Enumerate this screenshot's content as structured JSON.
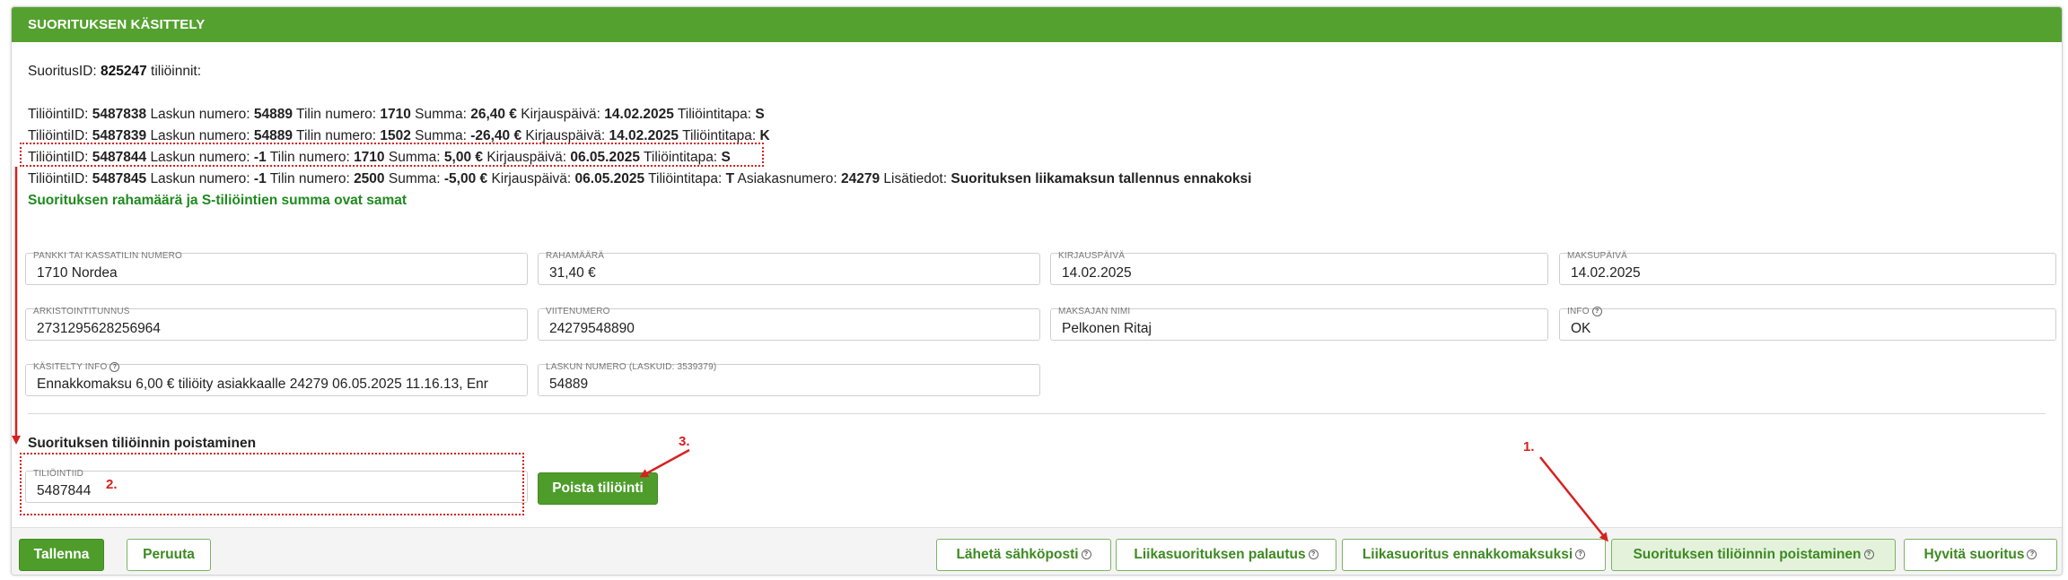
{
  "header": {
    "title": "SUORITUKSEN KÄSITTELY"
  },
  "suoritus": {
    "label": "SuoritusID:",
    "id": "825247",
    "suffix": "tiliöinnit:"
  },
  "entries": [
    {
      "tid_label": "TiliöintiID:",
      "tid": "5487838",
      "laskun_label": "Laskun numero:",
      "laskun": "54889",
      "tilin_label": "Tilin numero:",
      "tilin": "1710",
      "summa_label": "Summa:",
      "summa": "26,40 €",
      "kirj_label": "Kirjauspäivä:",
      "kirj": "14.02.2025",
      "tapa_label": "Tiliöintitapa:",
      "tapa": "S"
    },
    {
      "tid_label": "TiliöintiID:",
      "tid": "5487839",
      "laskun_label": "Laskun numero:",
      "laskun": "54889",
      "tilin_label": "Tilin numero:",
      "tilin": "1502",
      "summa_label": "Summa:",
      "summa": "-26,40 €",
      "kirj_label": "Kirjauspäivä:",
      "kirj": "14.02.2025",
      "tapa_label": "Tiliöintitapa:",
      "tapa": "K"
    },
    {
      "tid_label": "TiliöintiID:",
      "tid": "5487844",
      "laskun_label": "Laskun numero:",
      "laskun": "-1",
      "tilin_label": "Tilin numero:",
      "tilin": "1710",
      "summa_label": "Summa:",
      "summa": "5,00 €",
      "kirj_label": "Kirjauspäivä:",
      "kirj": "06.05.2025",
      "tapa_label": "Tiliöintitapa:",
      "tapa": "S"
    },
    {
      "tid_label": "TiliöintiID:",
      "tid": "5487845",
      "laskun_label": "Laskun numero:",
      "laskun": "-1",
      "tilin_label": "Tilin numero:",
      "tilin": "2500",
      "summa_label": "Summa:",
      "summa": "-5,00 €",
      "kirj_label": "Kirjauspäivä:",
      "kirj": "06.05.2025",
      "tapa_label": "Tiliöintitapa:",
      "tapa": "T",
      "asiakas_label": "Asiakasnumero:",
      "asiakas": "24279",
      "lisa_label": "Lisätiedot:",
      "lisa": "Suorituksen liikamaksun tallennus ennakoksi"
    }
  ],
  "success_message": "Suorituksen rahamäärä ja S-tiliöintien summa ovat samat",
  "fields": {
    "pankki": {
      "label": "PANKKI TAI KASSATILIN NUMERO",
      "value": "1710 Nordea"
    },
    "rahamaara": {
      "label": "RAHAMÄÄRÄ",
      "value": "31,40 €"
    },
    "kirjauspaiva": {
      "label": "KIRJAUSPÄIVÄ",
      "value": "14.02.2025"
    },
    "maksupaiva": {
      "label": "MAKSUPÄIVÄ",
      "value": "14.02.2025"
    },
    "arkistointitunnus": {
      "label": "ARKISTOINTITUNNUS",
      "value": "2731295628256964"
    },
    "viitenumero": {
      "label": "VIITENUMERO",
      "value": "24279548890"
    },
    "maksajan_nimi": {
      "label": "MAKSAJAN NIMI",
      "value": "Pelkonen Ritaj"
    },
    "info": {
      "label": "INFO",
      "value": "OK"
    },
    "kasitelty_info": {
      "label": "KÄSITELTY INFO",
      "value": "Ennakkomaksu 6,00 € tiliöity asiakkaalle 24279 06.05.2025 11.16.13, Enr"
    },
    "laskun_numero": {
      "label": "LASKUN NUMERO (LASKUID: 3539379)",
      "value": "54889"
    }
  },
  "removal": {
    "title": "Suorituksen tiliöinnin poistaminen",
    "field_label": "TILIÖINTIID",
    "field_value": "5487844",
    "button": "Poista tiliöinti"
  },
  "annotations": {
    "a1": "1.",
    "a2": "2.",
    "a3": "3."
  },
  "footer": {
    "save": "Tallenna",
    "cancel": "Peruuta",
    "email": "Lähetä sähköposti",
    "refund": "Liikasuorituksen palautus",
    "prepay": "Liikasuoritus ennakkomaksuksi",
    "remove": "Suorituksen tiliöinnin poistaminen",
    "approve": "Hyvitä suoritus"
  },
  "colors": {
    "header": "#55a12f",
    "success": "#1f8a1f",
    "annotation": "#d82020",
    "button": "#4e9d2b"
  },
  "icons": {
    "info": "question-circle-icon"
  }
}
